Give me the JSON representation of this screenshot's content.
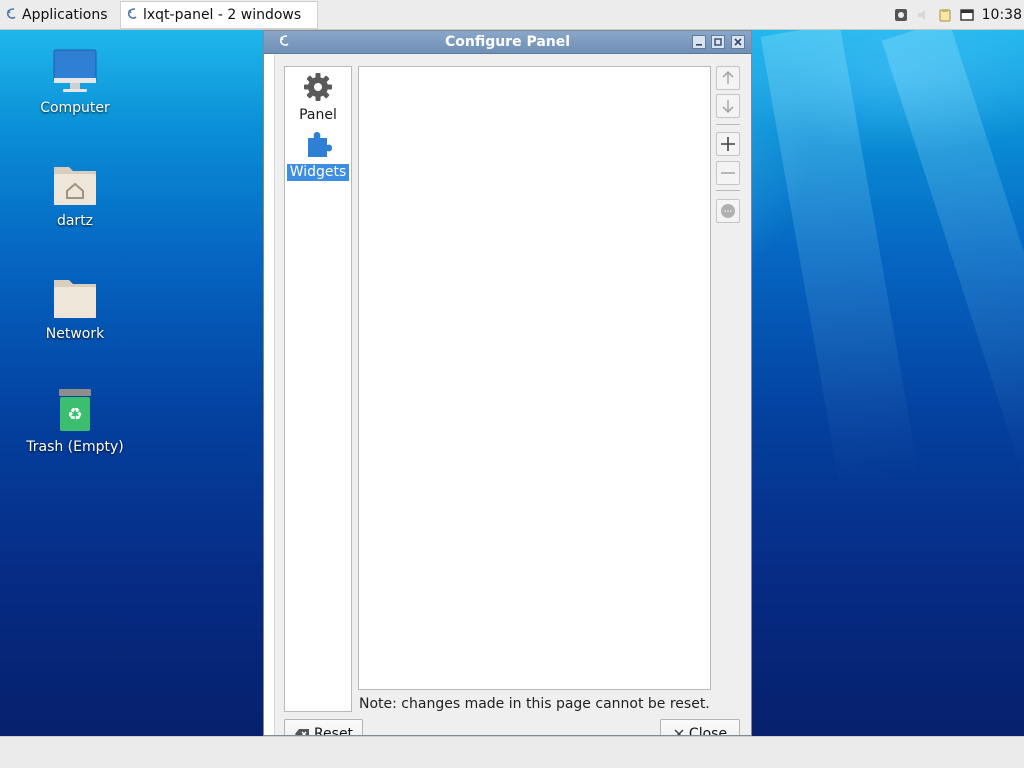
{
  "top_panel": {
    "app_menu_label": "Applications",
    "task_button_label": "lxqt-panel - 2 windows",
    "clock": "10:38"
  },
  "desktop": {
    "icons": [
      {
        "label": "Computer",
        "icon": "computer-icon"
      },
      {
        "label": "dartz",
        "icon": "home-folder-icon"
      },
      {
        "label": "Network",
        "icon": "network-folder-icon"
      },
      {
        "label": "Trash (Empty)",
        "icon": "trash-icon"
      }
    ]
  },
  "window": {
    "title": "Configure Panel",
    "pages": [
      {
        "label": "Panel",
        "icon": "gear-icon",
        "selected": false
      },
      {
        "label": "Widgets",
        "icon": "puzzle-icon",
        "selected": true
      }
    ],
    "side_buttons": [
      "move-up",
      "move-down",
      "add",
      "remove",
      "configure"
    ],
    "note": "Note: changes made in this page cannot be reset.",
    "reset_label": "Reset",
    "close_label": "Close"
  },
  "colors": {
    "selection": "#3d8ee0",
    "titlebar": "#7d9bc0",
    "desktop_top": "#1fb7ec",
    "desktop_bottom": "#06206c"
  }
}
